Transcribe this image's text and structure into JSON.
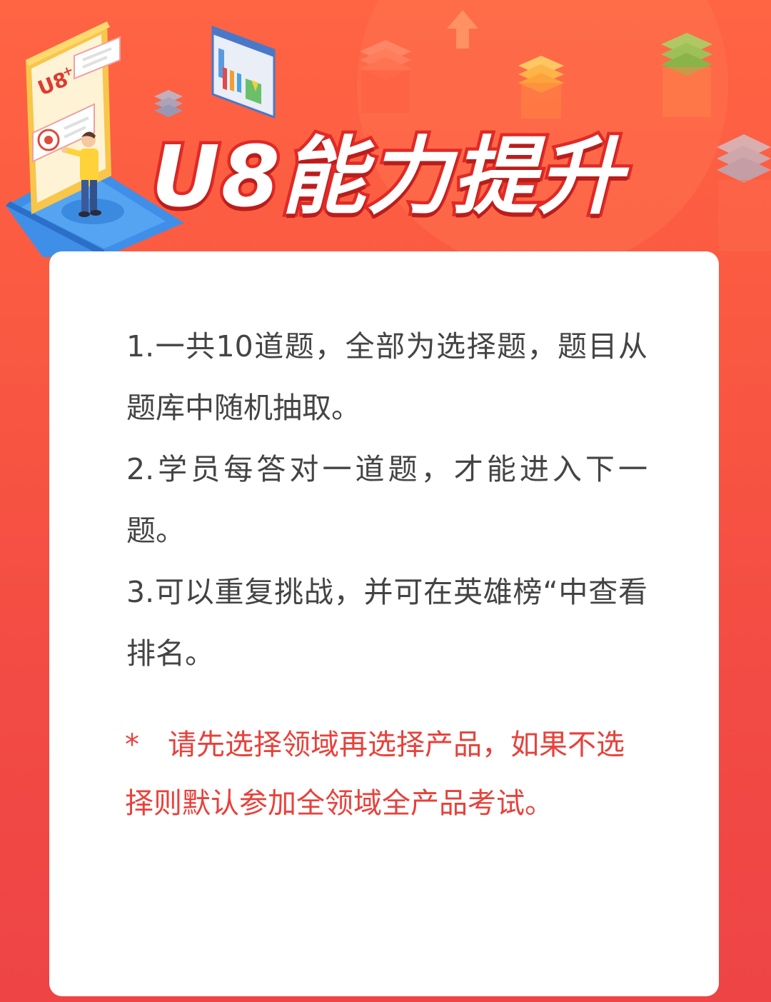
{
  "header": {
    "title": "U8能力提升",
    "illustration": {
      "phone_logo": "U8",
      "phone_logo_sup": "+"
    }
  },
  "rules": [
    "1.一共10道题，全部为选择题，题目从题库中随机抽取。",
    "2.学员每答对一道题，才能进入下一题。",
    "3.可以重复挑战，并可在英雄榜“中查看排名。"
  ],
  "note": {
    "star": "*",
    "text": "请先选择领域再选择产品，如果不选择则默认参加全领域全产品考试。"
  },
  "colors": {
    "background_top": "#ff6443",
    "background_bottom": "#ee4446",
    "card": "#ffffff",
    "rule_text": "#444444",
    "note_text": "#e8413b",
    "title_fill": "#ffffff",
    "title_stroke": "#e02a26"
  }
}
